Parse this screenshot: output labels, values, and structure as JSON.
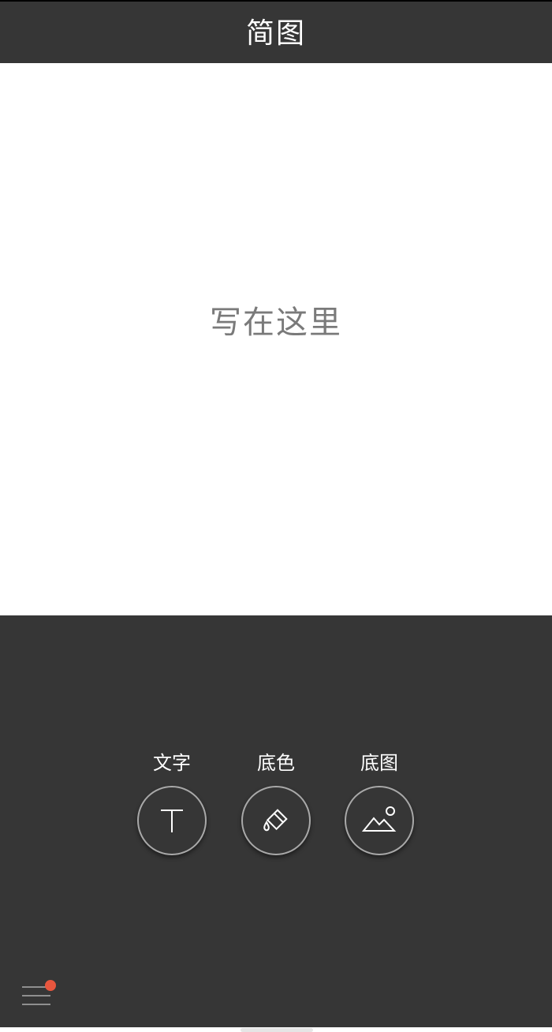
{
  "header": {
    "title": "简图"
  },
  "canvas": {
    "placeholder_text": "写在这里",
    "background_color": "#ffffff"
  },
  "tools": [
    {
      "label": "文字",
      "icon": "text-icon"
    },
    {
      "label": "底色",
      "icon": "paint-bucket-icon"
    },
    {
      "label": "底图",
      "icon": "image-icon"
    }
  ],
  "menu": {
    "icon": "menu-icon",
    "has_notification": true,
    "notification_color": "#e8563e"
  },
  "colors": {
    "toolbar_background": "#363636",
    "accent": "#e8563e"
  }
}
